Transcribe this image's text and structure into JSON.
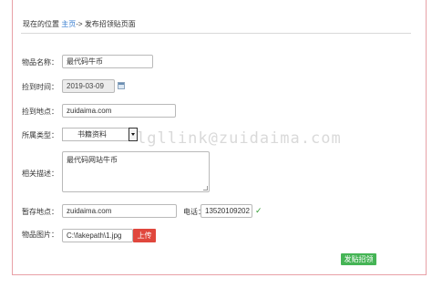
{
  "breadcrumb": {
    "prefix": "现在的位置",
    "home": "主页",
    "separator": "->",
    "current": "发布招领贴页面"
  },
  "form": {
    "item_name": {
      "label": "物品名称：",
      "value": "最代码牛币"
    },
    "found_time": {
      "label": "捡到时间：",
      "value": "2019-03-09"
    },
    "found_place": {
      "label": "捡到地点：",
      "value": "zuidaima.com"
    },
    "category": {
      "label": "所属类型：",
      "selected": "书籍资料"
    },
    "description": {
      "label": "相关描述：",
      "value": "最代码网站牛币"
    },
    "storage_place": {
      "label": "暂存地点：",
      "value": "zuidaima.com"
    },
    "phone": {
      "label": "电话：",
      "value": "13520109202",
      "valid_mark": "✓"
    },
    "image": {
      "label": "物品图片：",
      "value": "C:\\fakepath\\1.jpg",
      "upload_label": "上传"
    },
    "submit_label": "发贴招领"
  },
  "watermark": "lgllink@zuidaima.com",
  "colors": {
    "frame_border": "#e8a0a6",
    "link": "#3a7fd0",
    "upload_button": "#e0473d",
    "submit_button": "#45b455",
    "check": "#2f9a2f"
  }
}
